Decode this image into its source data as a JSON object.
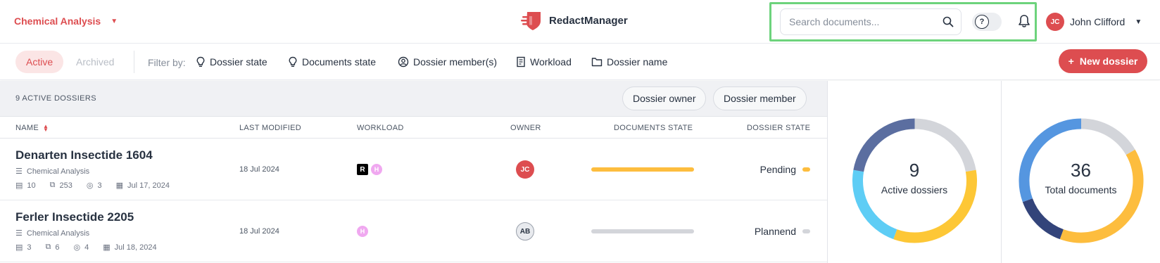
{
  "header": {
    "workspace": "Chemical Analysis",
    "brand": "RedactManager",
    "search_placeholder": "Search documents...",
    "help_icon": "?",
    "user": {
      "initials": "JC",
      "name": "John Clifford"
    }
  },
  "filterbar": {
    "tab_active": "Active",
    "tab_archived": "Archived",
    "filter_by": "Filter by:",
    "filters": [
      "Dossier state",
      "Documents state",
      "Dossier member(s)",
      "Workload",
      "Dossier name"
    ],
    "new_button": "New dossier"
  },
  "table": {
    "count_label": "9 ACTIVE DOSSIERS",
    "owner_button": "Dossier owner",
    "member_button": "Dossier member",
    "columns": [
      "NAME",
      "LAST MODIFIED",
      "WORKLOAD",
      "OWNER",
      "DOCUMENTS STATE",
      "DOSSIER STATE"
    ],
    "rows": [
      {
        "name": "Denarten Insectide 1604",
        "template": "Chemical Analysis",
        "files": "10",
        "pages": "253",
        "members": "3",
        "date": "Jul 17, 2024",
        "modified": "18 Jul 2024",
        "workload_r": "R",
        "workload_h": "H",
        "owner": "JC",
        "progress_color": "#fdbd3e",
        "state": "Pending",
        "state_color": "#fdbd3e"
      },
      {
        "name": "Ferler Insectide 2205",
        "template": "Chemical Analysis",
        "files": "3",
        "pages": "6",
        "members": "4",
        "date": "Jul 18, 2024",
        "modified": "18 Jul 2024",
        "workload_h": "H",
        "owner": "AB",
        "progress_color": "#d3d5da",
        "state": "Plannend",
        "state_color": "#d3d5da"
      }
    ]
  },
  "charts": {
    "active": {
      "value": "9",
      "label": "Active dossiers",
      "segments": [
        {
          "color": "#d3d5da",
          "value": 2
        },
        {
          "color": "#fdc736",
          "value": 3
        },
        {
          "color": "#5ecdf5",
          "value": 2
        },
        {
          "color": "#5b6ea0",
          "value": 2
        }
      ]
    },
    "total": {
      "value": "36",
      "label": "Total documents",
      "segments": [
        {
          "color": "#d3d5da",
          "value": 6
        },
        {
          "color": "#fdbd3e",
          "value": 14
        },
        {
          "color": "#33447a",
          "value": 5
        },
        {
          "color": "#5596e0",
          "value": 11
        }
      ]
    }
  }
}
